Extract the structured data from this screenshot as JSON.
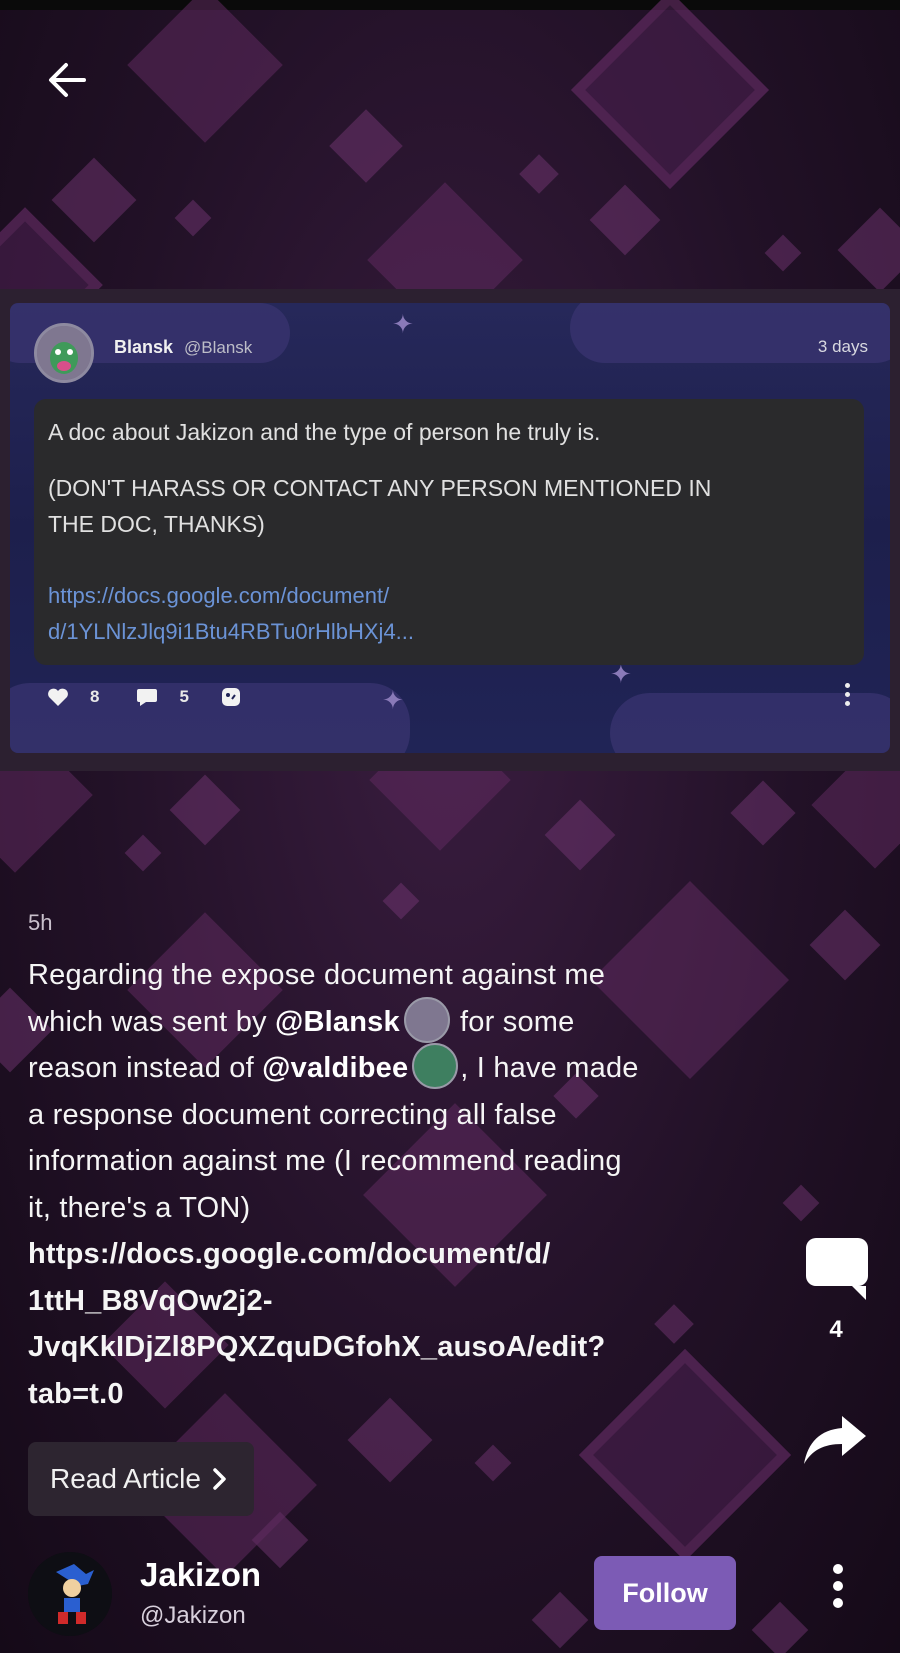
{
  "embed": {
    "author_name": "Blansk",
    "author_handle": "@Blansk",
    "time": "3 days",
    "line1": "A doc about Jakizon and the type of person he truly is.",
    "line2": "(DON'T HARASS OR CONTACT ANY PERSON MENTIONED IN",
    "line3": "THE DOC, THANKS)",
    "link1": "https://docs.google.com/document/",
    "link2": "d/1YLNlzJlq9i1Btu4RBTu0rHlbHXj4...",
    "likes": "8",
    "comments": "5"
  },
  "post": {
    "time": "5h",
    "t1": "Regarding the expose document against me",
    "t2a": "which was sent by ",
    "mention1": "@Blansk",
    "t2b": " for some",
    "t3a": "reason instead of ",
    "mention2": "@valdibee",
    "t3b": ", I have made",
    "t4": "a response document correcting all false",
    "t5": "information against me (I recommend reading",
    "t6": "it, there's a TON)",
    "l1": "https://docs.google.com/document/d/",
    "l2": "1ttH_B8VqOw2j2-",
    "l3": "JvqKkIDjZl8PQXZquDGfohX_ausoA/edit?",
    "l4": "tab=t.0",
    "read_label": "Read Article"
  },
  "sidebar": {
    "comment_count": "4"
  },
  "author": {
    "name": "Jakizon",
    "handle": "@Jakizon",
    "follow_label": "Follow"
  },
  "colors": {
    "accent": "#7c5bb5",
    "link": "#6b93d6",
    "background": "#221127"
  },
  "icons": [
    "back-arrow-icon",
    "heart-icon",
    "comment-icon",
    "share-icon",
    "more-icon",
    "reaction-icon"
  ]
}
